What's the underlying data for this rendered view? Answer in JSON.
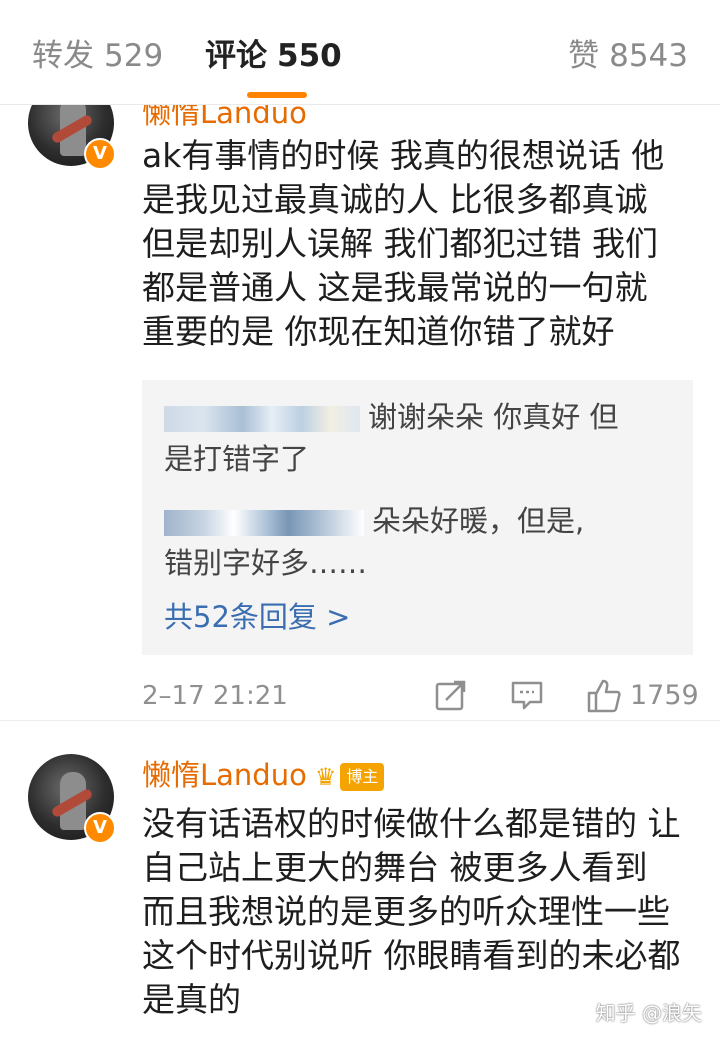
{
  "tabs": {
    "repost_label": "转发",
    "repost_count": "529",
    "comment_label": "评论",
    "comment_count": "550",
    "like_label": "赞",
    "like_count": "8543",
    "active_color": "#ff8200"
  },
  "comment1": {
    "author": "懒惰Landuo",
    "verified_badge": "V",
    "text_lines": [
      "ak有事情的时候 我真的很想说话 他",
      "是我见过最真诚的人 比很多都真诚",
      "但是却别人误解 我们都犯过错 我们",
      "都是普通人 这是我最常说的一句就",
      "重要的是 你现在知道你错了就好"
    ],
    "replies": [
      {
        "lines": [
          "谢谢朵朵 你真好 但",
          "是打错字了"
        ]
      },
      {
        "lines": [
          "朵朵好暖，但是,",
          "错别字好多……"
        ]
      }
    ],
    "more_replies": "共52条回复 >",
    "time": "2–17 21:21",
    "like_count": "1759"
  },
  "comment2": {
    "author": "懒惰Landuo",
    "blogger_tag": "博主",
    "verified_badge": "V",
    "text_lines": [
      "没有话语权的时候做什么都是错的 让",
      "自己站上更大的舞台 被更多人看到",
      "而且我想说的是更多的听众理性一些",
      "这个时代别说听 你眼睛看到的未必都",
      "是真的"
    ]
  },
  "watermark": "知乎 @浪矢",
  "colors": {
    "author": "#e66b00",
    "link": "#3a6eb0",
    "reply_bg": "#f4f4f4",
    "badge": "#ff8a00"
  },
  "icons": [
    "share-icon",
    "comment-icon",
    "thumbs-up-icon",
    "crown-icon"
  ]
}
